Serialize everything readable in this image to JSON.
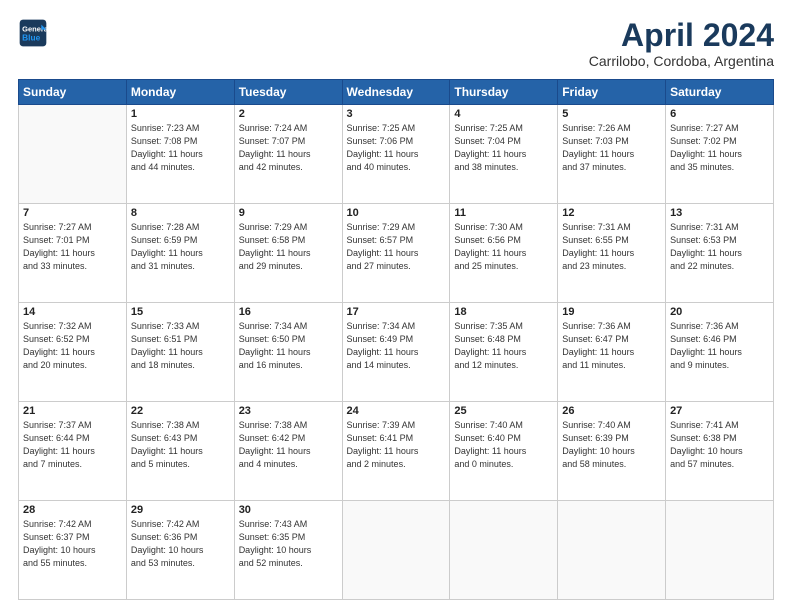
{
  "header": {
    "logo_line1": "General",
    "logo_line2": "Blue",
    "title": "April 2024",
    "subtitle": "Carrilobo, Cordoba, Argentina"
  },
  "weekdays": [
    "Sunday",
    "Monday",
    "Tuesday",
    "Wednesday",
    "Thursday",
    "Friday",
    "Saturday"
  ],
  "weeks": [
    [
      {
        "day": "",
        "info": ""
      },
      {
        "day": "1",
        "info": "Sunrise: 7:23 AM\nSunset: 7:08 PM\nDaylight: 11 hours\nand 44 minutes."
      },
      {
        "day": "2",
        "info": "Sunrise: 7:24 AM\nSunset: 7:07 PM\nDaylight: 11 hours\nand 42 minutes."
      },
      {
        "day": "3",
        "info": "Sunrise: 7:25 AM\nSunset: 7:06 PM\nDaylight: 11 hours\nand 40 minutes."
      },
      {
        "day": "4",
        "info": "Sunrise: 7:25 AM\nSunset: 7:04 PM\nDaylight: 11 hours\nand 38 minutes."
      },
      {
        "day": "5",
        "info": "Sunrise: 7:26 AM\nSunset: 7:03 PM\nDaylight: 11 hours\nand 37 minutes."
      },
      {
        "day": "6",
        "info": "Sunrise: 7:27 AM\nSunset: 7:02 PM\nDaylight: 11 hours\nand 35 minutes."
      }
    ],
    [
      {
        "day": "7",
        "info": "Sunrise: 7:27 AM\nSunset: 7:01 PM\nDaylight: 11 hours\nand 33 minutes."
      },
      {
        "day": "8",
        "info": "Sunrise: 7:28 AM\nSunset: 6:59 PM\nDaylight: 11 hours\nand 31 minutes."
      },
      {
        "day": "9",
        "info": "Sunrise: 7:29 AM\nSunset: 6:58 PM\nDaylight: 11 hours\nand 29 minutes."
      },
      {
        "day": "10",
        "info": "Sunrise: 7:29 AM\nSunset: 6:57 PM\nDaylight: 11 hours\nand 27 minutes."
      },
      {
        "day": "11",
        "info": "Sunrise: 7:30 AM\nSunset: 6:56 PM\nDaylight: 11 hours\nand 25 minutes."
      },
      {
        "day": "12",
        "info": "Sunrise: 7:31 AM\nSunset: 6:55 PM\nDaylight: 11 hours\nand 23 minutes."
      },
      {
        "day": "13",
        "info": "Sunrise: 7:31 AM\nSunset: 6:53 PM\nDaylight: 11 hours\nand 22 minutes."
      }
    ],
    [
      {
        "day": "14",
        "info": "Sunrise: 7:32 AM\nSunset: 6:52 PM\nDaylight: 11 hours\nand 20 minutes."
      },
      {
        "day": "15",
        "info": "Sunrise: 7:33 AM\nSunset: 6:51 PM\nDaylight: 11 hours\nand 18 minutes."
      },
      {
        "day": "16",
        "info": "Sunrise: 7:34 AM\nSunset: 6:50 PM\nDaylight: 11 hours\nand 16 minutes."
      },
      {
        "day": "17",
        "info": "Sunrise: 7:34 AM\nSunset: 6:49 PM\nDaylight: 11 hours\nand 14 minutes."
      },
      {
        "day": "18",
        "info": "Sunrise: 7:35 AM\nSunset: 6:48 PM\nDaylight: 11 hours\nand 12 minutes."
      },
      {
        "day": "19",
        "info": "Sunrise: 7:36 AM\nSunset: 6:47 PM\nDaylight: 11 hours\nand 11 minutes."
      },
      {
        "day": "20",
        "info": "Sunrise: 7:36 AM\nSunset: 6:46 PM\nDaylight: 11 hours\nand 9 minutes."
      }
    ],
    [
      {
        "day": "21",
        "info": "Sunrise: 7:37 AM\nSunset: 6:44 PM\nDaylight: 11 hours\nand 7 minutes."
      },
      {
        "day": "22",
        "info": "Sunrise: 7:38 AM\nSunset: 6:43 PM\nDaylight: 11 hours\nand 5 minutes."
      },
      {
        "day": "23",
        "info": "Sunrise: 7:38 AM\nSunset: 6:42 PM\nDaylight: 11 hours\nand 4 minutes."
      },
      {
        "day": "24",
        "info": "Sunrise: 7:39 AM\nSunset: 6:41 PM\nDaylight: 11 hours\nand 2 minutes."
      },
      {
        "day": "25",
        "info": "Sunrise: 7:40 AM\nSunset: 6:40 PM\nDaylight: 11 hours\nand 0 minutes."
      },
      {
        "day": "26",
        "info": "Sunrise: 7:40 AM\nSunset: 6:39 PM\nDaylight: 10 hours\nand 58 minutes."
      },
      {
        "day": "27",
        "info": "Sunrise: 7:41 AM\nSunset: 6:38 PM\nDaylight: 10 hours\nand 57 minutes."
      }
    ],
    [
      {
        "day": "28",
        "info": "Sunrise: 7:42 AM\nSunset: 6:37 PM\nDaylight: 10 hours\nand 55 minutes."
      },
      {
        "day": "29",
        "info": "Sunrise: 7:42 AM\nSunset: 6:36 PM\nDaylight: 10 hours\nand 53 minutes."
      },
      {
        "day": "30",
        "info": "Sunrise: 7:43 AM\nSunset: 6:35 PM\nDaylight: 10 hours\nand 52 minutes."
      },
      {
        "day": "",
        "info": ""
      },
      {
        "day": "",
        "info": ""
      },
      {
        "day": "",
        "info": ""
      },
      {
        "day": "",
        "info": ""
      }
    ]
  ]
}
